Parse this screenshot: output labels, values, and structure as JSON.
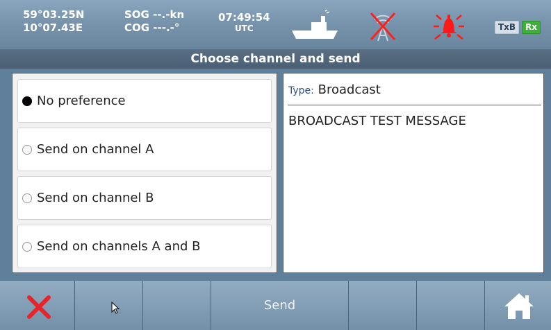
{
  "status": {
    "lat": "59°03.25N",
    "lon": "10°07.43E",
    "sog": "SOG --.-kn",
    "cog": "COG ---.-°",
    "time": "07:49:54",
    "timezone": "UTC",
    "icons": [
      "ship-icon",
      "antenna-disabled-icon",
      "alarm-bell-icon"
    ],
    "txb": "TxB",
    "rx": "Rx"
  },
  "title": "Choose channel and send",
  "options": [
    {
      "label": "No preference",
      "selected": true
    },
    {
      "label": "Send on channel A",
      "selected": false
    },
    {
      "label": "Send on channel B",
      "selected": false
    },
    {
      "label": "Send on channels A and B",
      "selected": false
    }
  ],
  "message": {
    "type_label": "Type:",
    "type_value": "Broadcast",
    "text": "BROADCAST TEST MESSAGE"
  },
  "bottombar": {
    "send_label": "Send",
    "icons": [
      "cancel-icon",
      "home-icon"
    ]
  },
  "colors": {
    "status_bg": "#7894ad",
    "title_bg": "#54687d",
    "rx_badge": "#3db13a",
    "alarm": "#ff1a1a",
    "cancel": "#e8242a"
  }
}
